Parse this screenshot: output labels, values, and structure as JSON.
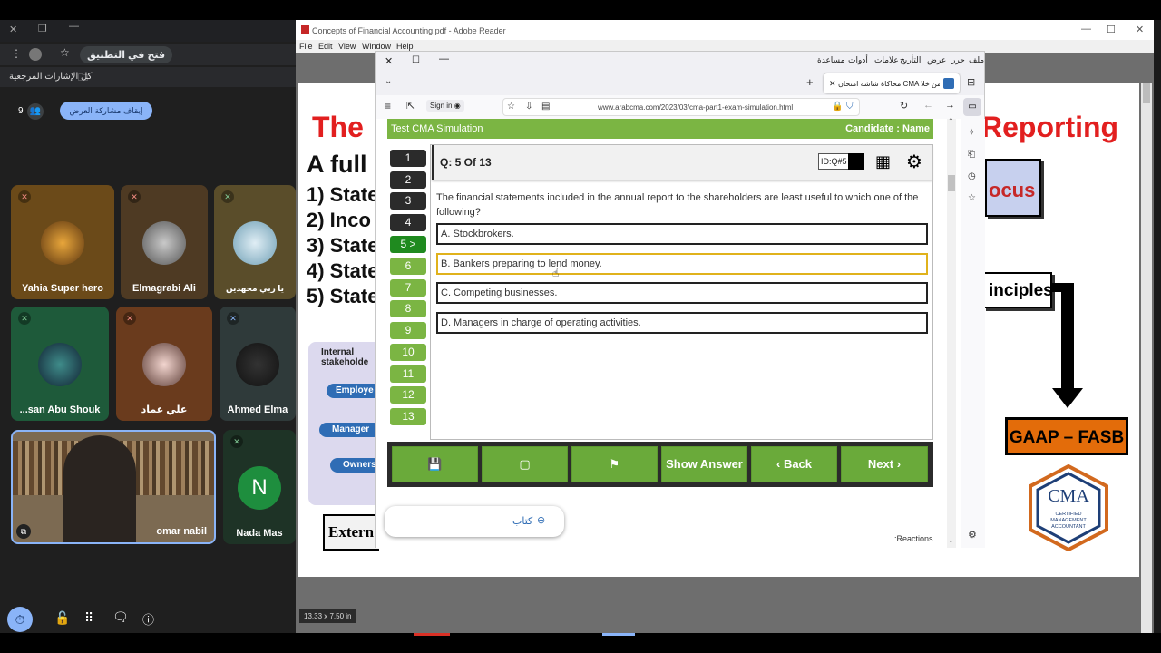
{
  "meet": {
    "open_in_app": "فتح في التطبيق",
    "bookmarks": "كل الإشارات المرجعية",
    "participants_count": "9",
    "stop_presenting": "إيقاف مشاركة العرض",
    "tiles": [
      {
        "name": "Yahia Super hero"
      },
      {
        "name": "Elmagrabi Ali"
      },
      {
        "name": "يا ربي مجهدين"
      },
      {
        "name": "...san Abu Shouk"
      },
      {
        "name": "علي عماد"
      },
      {
        "name": "Ahmed Elma"
      },
      {
        "name": "omar nabil"
      },
      {
        "name": "Nada Mas",
        "initial": "N"
      }
    ]
  },
  "adobe": {
    "title": "Concepts of Financial Accounting.pdf - Adobe Reader",
    "menu": [
      "File",
      "Edit",
      "View",
      "Window",
      "Help"
    ],
    "page_size": "13.33 x 7.50 in",
    "slide": {
      "title_left": "The",
      "title_right": "Reporting",
      "heading": "A full",
      "list": [
        "1) State",
        "2) Inco",
        "3) State",
        "4) State",
        "5) State"
      ],
      "box_focus": "ocus",
      "box_principles": "inciples",
      "gaap": "GAAP – FASB",
      "internal": "Internal stakeholde",
      "pills": [
        "Employe",
        "Manager",
        "Owners"
      ],
      "external": "Extern",
      "cma_logo": "CMA",
      "cma_sub": "CERTIFIED MANAGEMENT ACCOUNTANT"
    }
  },
  "browser": {
    "menu": [
      "ملف",
      "حرر",
      "عرض",
      "التأريخ",
      "علامات",
      "أدوات",
      "مساعدة"
    ],
    "tab_title": "محاكاة شاشة امتحان CMA من خلا",
    "sign_in": "Sign in",
    "url": "www.arabcma.com/2023/03/cma-part1-exam-simulation.html",
    "exam": {
      "header_left": "Test CMA Simulation",
      "header_right": "Candidate : Name",
      "question_label": "Q: 5 Of 13",
      "question_id": "ID:Q#5",
      "question_text": "The financial statements included in the annual report to the shareholders are least useful to which one of the following?",
      "options": [
        "A. Stockbrokers.",
        "B. Bankers preparing to lend money.",
        "C. Competing businesses.",
        "D. Managers in charge of operating activities."
      ],
      "numbers": [
        "1",
        "2",
        "3",
        "4",
        "5 >",
        "6",
        "7",
        "8",
        "9",
        "10",
        "11",
        "12",
        "13"
      ],
      "show_answer": "Show Answer",
      "back": "Back",
      "next": "Next",
      "book_button": "كتاب",
      "reactions": ":Reactions"
    }
  }
}
